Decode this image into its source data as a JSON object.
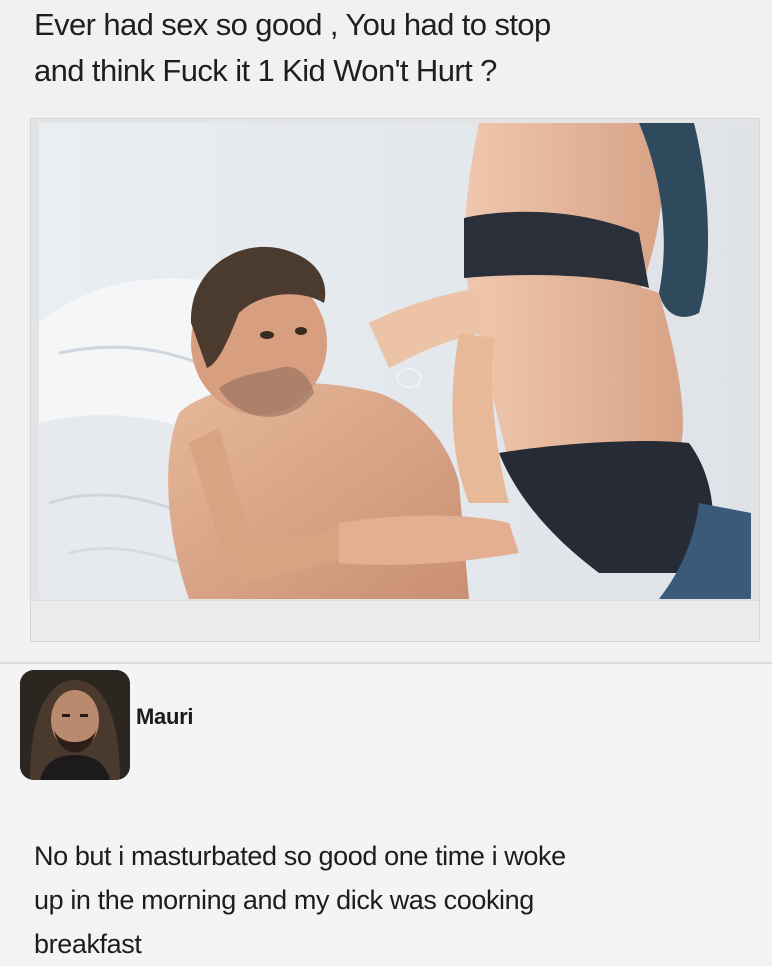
{
  "post": {
    "caption_lines": [
      "Ever had sex so good , You had to stop",
      "and think  Fuck it 1 Kid Won't Hurt ?"
    ]
  },
  "comment": {
    "author": "Mauri",
    "text_lines": [
      "No but i masturbated so good one time i woke",
      "up in the morning and my dick was cooking",
      "breakfast"
    ]
  }
}
